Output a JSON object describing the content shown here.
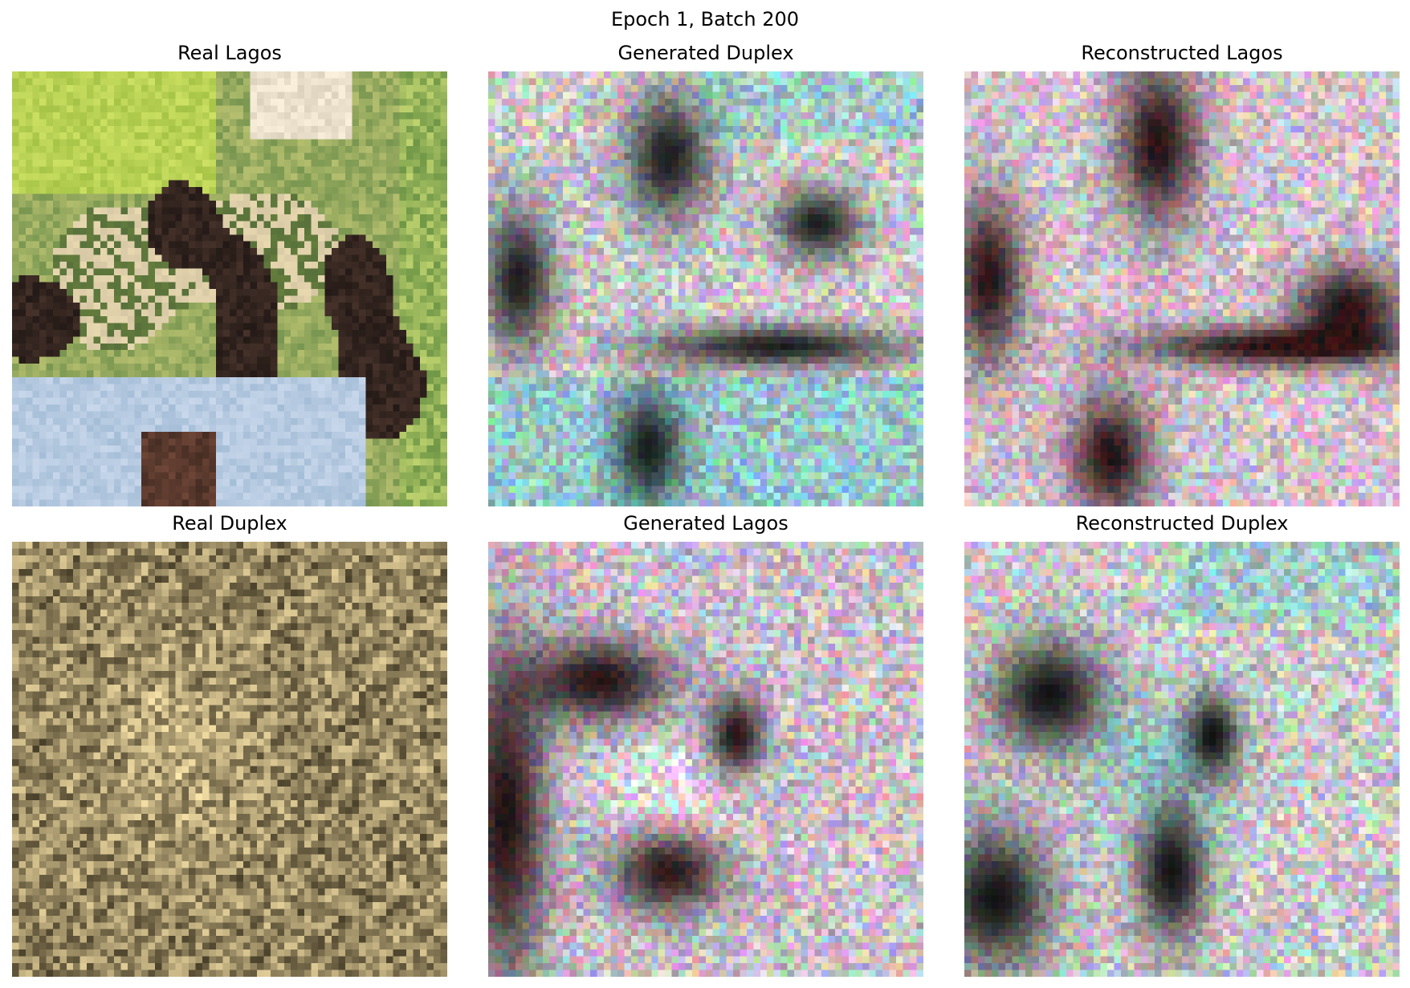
{
  "figure": {
    "suptitle": "Epoch 1, Batch 200",
    "panels": [
      {
        "title": "Real Lagos",
        "kind": "real_lagos"
      },
      {
        "title": "Generated Duplex",
        "kind": "gen_duplex"
      },
      {
        "title": "Reconstructed Lagos",
        "kind": "rec_lagos"
      },
      {
        "title": "Real Duplex",
        "kind": "real_duplex"
      },
      {
        "title": "Generated Lagos",
        "kind": "gen_lagos"
      },
      {
        "title": "Reconstructed Duplex",
        "kind": "rec_duplex"
      }
    ]
  }
}
